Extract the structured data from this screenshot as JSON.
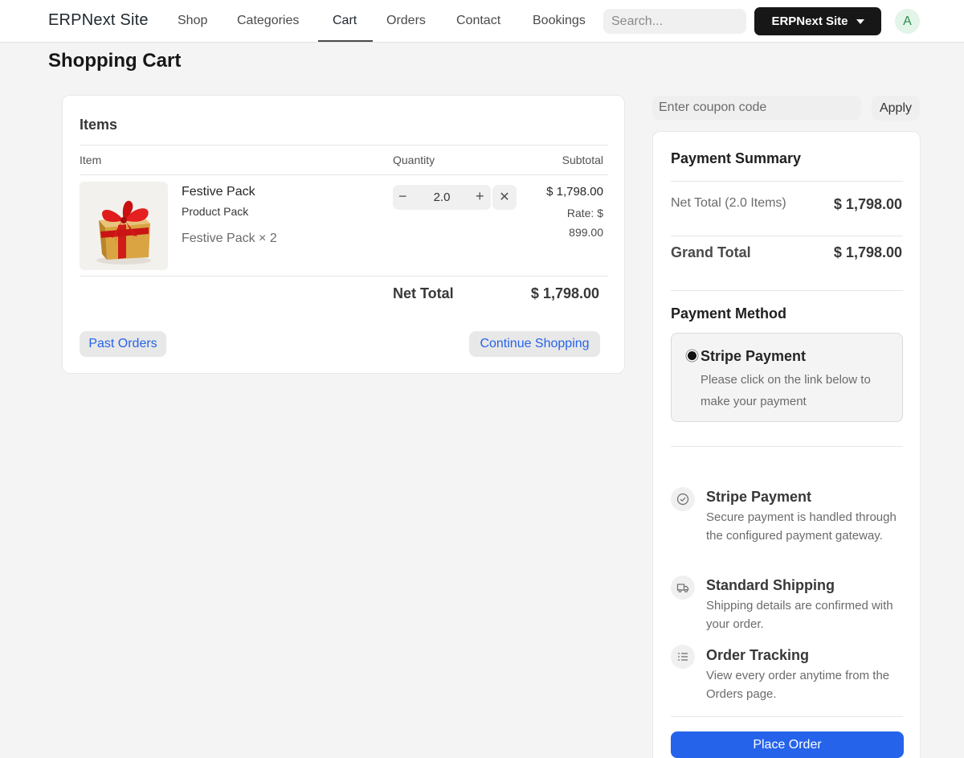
{
  "navbar": {
    "brand": "ERPNext Site",
    "links": [
      "Shop",
      "Categories",
      "Cart",
      "Orders",
      "Contact",
      "Bookings"
    ],
    "active_link": "Cart",
    "search_placeholder": "Search...",
    "site_button": "ERPNext Site",
    "avatar_initial": "A"
  },
  "page": {
    "title": "Shopping Cart"
  },
  "cart": {
    "title": "Items",
    "columns": {
      "item": "Item",
      "quantity": "Quantity",
      "subtotal": "Subtotal"
    },
    "items": [
      {
        "name": "Festive Pack",
        "group": "Product Pack",
        "description": "Festive Pack × 2",
        "quantity": "2.0",
        "subtotal": "$ 1,798.00",
        "rate": "Rate: $ 899.00",
        "image_icon": "gift-box-icon"
      }
    ],
    "net_total_label": "Net Total",
    "net_total": "$ 1,798.00",
    "past_orders_label": "Past Orders",
    "continue_shopping_label": "Continue Shopping"
  },
  "coupon": {
    "placeholder": "Enter coupon code",
    "apply_label": "Apply"
  },
  "summary": {
    "title": "Payment Summary",
    "net_total_label": "Net Total (2.0 Items)",
    "net_total": "$ 1,798.00",
    "grand_total_label": "Grand Total",
    "grand_total": "$ 1,798.00"
  },
  "payment_method": {
    "title": "Payment Method",
    "selected": "Stripe Payment",
    "description": "Please click on the link below to make your payment"
  },
  "features": [
    {
      "icon": "check-circle-icon",
      "title": "Stripe Payment",
      "description": "Secure payment is handled through the configured payment gateway."
    },
    {
      "icon": "truck-icon",
      "title": "Standard Shipping",
      "description": "Shipping details are confirmed with your order."
    },
    {
      "icon": "list-icon",
      "title": "Order Tracking",
      "description": "View every order anytime from the Orders page."
    }
  ],
  "place_order_label": "Place Order",
  "colors": {
    "primary": "#2563eb",
    "dark_button": "#171717",
    "avatar_bg": "#e3f4e8",
    "avatar_text": "#2e8c4e"
  }
}
